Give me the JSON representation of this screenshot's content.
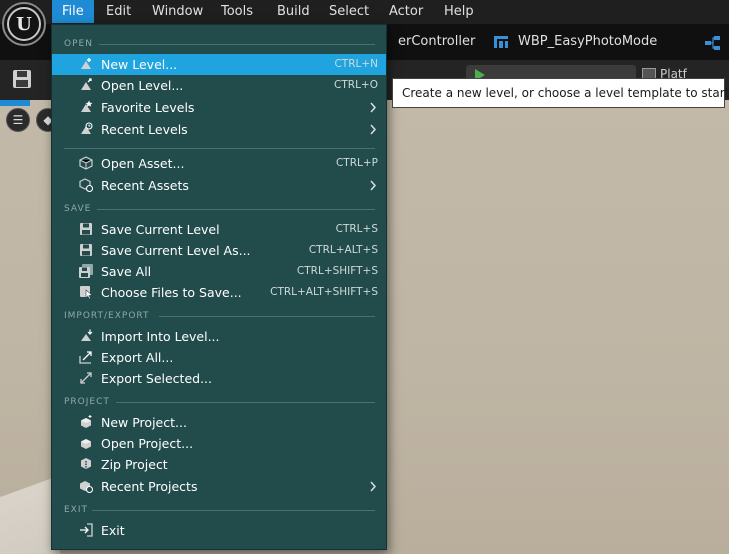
{
  "menubar": {
    "items": [
      "File",
      "Edit",
      "Window",
      "Tools",
      "Build",
      "Select",
      "Actor",
      "Help"
    ],
    "active": "File"
  },
  "tabs": {
    "items": [
      {
        "label": "erController"
      },
      {
        "label": "WBP_EasyPhotoMode"
      }
    ]
  },
  "toolbar": {
    "platforms_label": "Platf"
  },
  "file_menu": {
    "sections": [
      {
        "title": "OPEN",
        "items": [
          {
            "label": "New Level...",
            "shortcut": "CTRL+N",
            "icon": "new-level-icon",
            "highlighted": true
          },
          {
            "label": "Open Level...",
            "shortcut": "CTRL+O",
            "icon": "open-level-icon"
          },
          {
            "label": "Favorite Levels",
            "submenu": true,
            "icon": "favorite-levels-icon"
          },
          {
            "label": "Recent Levels",
            "submenu": true,
            "icon": "recent-levels-icon"
          },
          {
            "label": "Open Asset...",
            "shortcut": "CTRL+P",
            "icon": "open-asset-icon"
          },
          {
            "label": "Recent Assets",
            "submenu": true,
            "icon": "recent-assets-icon"
          }
        ]
      },
      {
        "title": "SAVE",
        "items": [
          {
            "label": "Save Current Level",
            "shortcut": "CTRL+S",
            "icon": "save-icon"
          },
          {
            "label": "Save Current Level As...",
            "shortcut": "CTRL+ALT+S",
            "icon": "save-as-icon"
          },
          {
            "label": "Save All",
            "shortcut": "CTRL+SHIFT+S",
            "icon": "save-all-icon"
          },
          {
            "label": "Choose Files to Save...",
            "shortcut": "CTRL+ALT+SHIFT+S",
            "icon": "choose-files-icon"
          }
        ]
      },
      {
        "title": "IMPORT/EXPORT",
        "items": [
          {
            "label": "Import Into Level...",
            "icon": "import-icon"
          },
          {
            "label": "Export All...",
            "icon": "export-icon"
          },
          {
            "label": "Export Selected...",
            "icon": "export-selected-icon"
          }
        ]
      },
      {
        "title": "PROJECT",
        "items": [
          {
            "label": "New Project...",
            "icon": "new-project-icon"
          },
          {
            "label": "Open Project...",
            "icon": "open-project-icon"
          },
          {
            "label": "Zip Project",
            "icon": "zip-project-icon"
          },
          {
            "label": "Recent Projects",
            "submenu": true,
            "icon": "recent-projects-icon"
          }
        ]
      },
      {
        "title": "EXIT",
        "items": [
          {
            "label": "Exit",
            "icon": "exit-icon"
          }
        ]
      }
    ]
  },
  "tooltip": {
    "text": "Create a new level, or choose a level template to start from."
  },
  "colors": {
    "menu_bg": "#224b4c",
    "highlight": "#1fa4e0",
    "active_menu": "#1e8bd4"
  }
}
